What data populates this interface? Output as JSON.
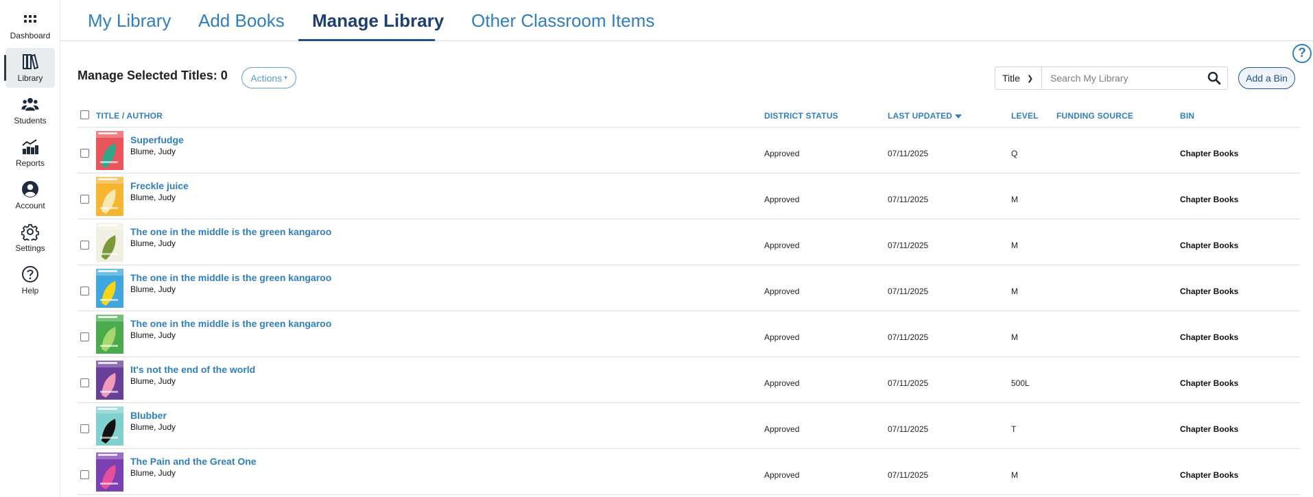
{
  "sidebar": {
    "items": [
      {
        "label": "Dashboard",
        "icon": "grid-icon"
      },
      {
        "label": "Library",
        "icon": "books-icon",
        "active": true
      },
      {
        "label": "Students",
        "icon": "students-icon"
      },
      {
        "label": "Reports",
        "icon": "reports-icon"
      },
      {
        "label": "Account",
        "icon": "account-icon"
      },
      {
        "label": "Settings",
        "icon": "gear-icon"
      },
      {
        "label": "Help",
        "icon": "help-icon"
      }
    ]
  },
  "tabs": [
    {
      "label": "My Library"
    },
    {
      "label": "Add Books"
    },
    {
      "label": "Manage Library",
      "active": true
    },
    {
      "label": "Other Classroom Items"
    }
  ],
  "help_button": "?",
  "toolbar": {
    "manage_title": "Manage Selected Titles: 0",
    "actions_label": "Actions",
    "search_field": "Title",
    "search_placeholder": "Search My Library",
    "add_bin_label": "Add a Bin"
  },
  "table": {
    "headers": {
      "title": "Title",
      "separator": "/",
      "author": "Author",
      "district_status": "District Status",
      "last_updated": "Last Updated",
      "level": "Level",
      "funding_source": "Funding Source",
      "bin": "Bin"
    },
    "rows": [
      {
        "title": "Superfudge",
        "author": "Blume, Judy",
        "status": "Approved",
        "updated": "07/11/2025",
        "level": "Q",
        "funding": "",
        "bin": "Chapter Books",
        "cover_color": "#e8555a",
        "cover_accent": "#2fa88a"
      },
      {
        "title": "Freckle juice",
        "author": "Blume, Judy",
        "status": "Approved",
        "updated": "07/11/2025",
        "level": "M",
        "funding": "",
        "bin": "Chapter Books",
        "cover_color": "#f6b531",
        "cover_accent": "#f7e9b0"
      },
      {
        "title": "The one in the middle is the green kangaroo",
        "author": "Blume, Judy",
        "status": "Approved",
        "updated": "07/11/2025",
        "level": "M",
        "funding": "",
        "bin": "Chapter Books",
        "cover_color": "#f2efe2",
        "cover_accent": "#7a9a3a"
      },
      {
        "title": "The one in the middle is the green kangaroo",
        "author": "Blume, Judy",
        "status": "Approved",
        "updated": "07/11/2025",
        "level": "M",
        "funding": "",
        "bin": "Chapter Books",
        "cover_color": "#3fa6df",
        "cover_accent": "#f5d514"
      },
      {
        "title": "The one in the middle is the green kangaroo",
        "author": "Blume, Judy",
        "status": "Approved",
        "updated": "07/11/2025",
        "level": "M",
        "funding": "",
        "bin": "Chapter Books",
        "cover_color": "#4aab4e",
        "cover_accent": "#a7d86e"
      },
      {
        "title": "It's not the end of the world",
        "author": "Blume, Judy",
        "status": "Approved",
        "updated": "07/11/2025",
        "level": "500L",
        "funding": "",
        "bin": "Chapter Books",
        "cover_color": "#6a3f9a",
        "cover_accent": "#f29ab8"
      },
      {
        "title": "Blubber",
        "author": "Blume, Judy",
        "status": "Approved",
        "updated": "07/11/2025",
        "level": "T",
        "funding": "",
        "bin": "Chapter Books",
        "cover_color": "#7fd0cf",
        "cover_accent": "#111111"
      },
      {
        "title": "The Pain and the Great One",
        "author": "Blume, Judy",
        "status": "Approved",
        "updated": "07/11/2025",
        "level": "M",
        "funding": "",
        "bin": "Chapter Books",
        "cover_color": "#7a3fb0",
        "cover_accent": "#e84f9a"
      }
    ]
  }
}
